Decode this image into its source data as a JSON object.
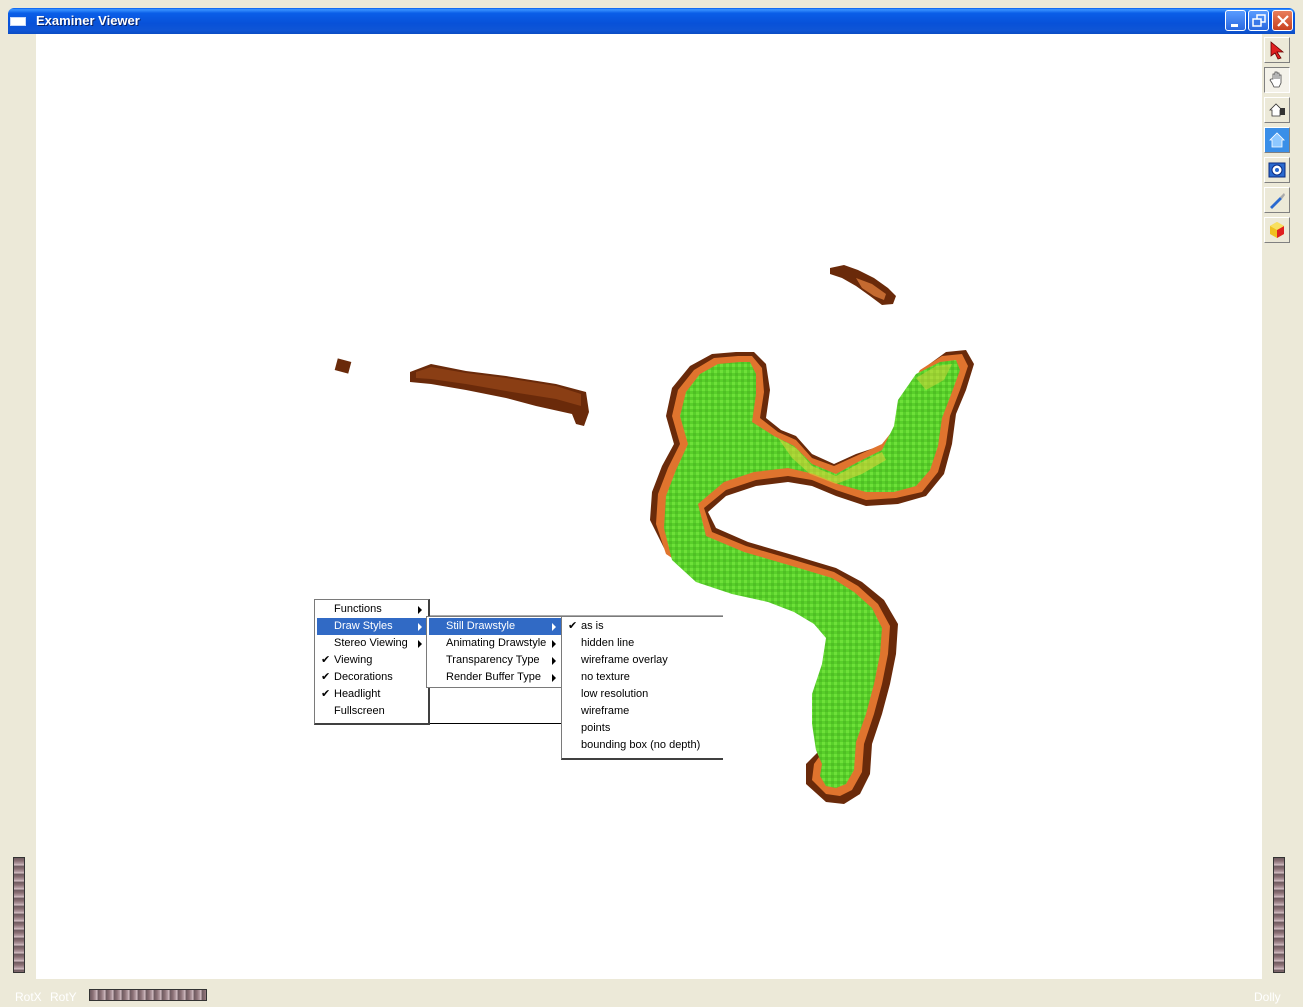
{
  "window": {
    "title": "Examiner Viewer",
    "buttons": [
      "minimize",
      "restore",
      "close"
    ]
  },
  "toolbar": {
    "tools": [
      {
        "name": "pick-arrow-icon",
        "pressed": false
      },
      {
        "name": "view-hand-icon",
        "pressed": true
      },
      {
        "name": "home-icon",
        "pressed": false
      },
      {
        "name": "set-home-icon",
        "pressed": false
      },
      {
        "name": "view-all-icon",
        "pressed": false
      },
      {
        "name": "seek-icon",
        "pressed": false
      },
      {
        "name": "perspective-cube-icon",
        "pressed": false
      }
    ]
  },
  "bottom_bar": {
    "rotx_label": "RotX",
    "roty_label": "RotY",
    "dolly_label": "Dolly"
  },
  "popup_menu": {
    "items": [
      {
        "label": "Functions",
        "checked": false,
        "submenu": true
      },
      {
        "label": "Draw Styles",
        "checked": false,
        "submenu": true,
        "selected": true
      },
      {
        "label": "Stereo Viewing",
        "checked": false,
        "submenu": true
      },
      {
        "label": "Viewing",
        "checked": true,
        "submenu": false
      },
      {
        "label": "Decorations",
        "checked": true,
        "submenu": false
      },
      {
        "label": "Headlight",
        "checked": true,
        "submenu": false
      },
      {
        "label": "Fullscreen",
        "checked": false,
        "submenu": false
      }
    ]
  },
  "draw_styles_menu": {
    "items": [
      {
        "label": "Still Drawstyle",
        "submenu": true,
        "selected": true
      },
      {
        "label": "Animating Drawstyle",
        "submenu": true
      },
      {
        "label": "Transparency Type",
        "submenu": true
      },
      {
        "label": "Render Buffer Type",
        "submenu": true
      }
    ]
  },
  "still_drawstyle_menu": {
    "items": [
      {
        "label": "as is",
        "checked": true
      },
      {
        "label": "hidden line",
        "checked": false
      },
      {
        "label": "wireframe overlay",
        "checked": false
      },
      {
        "label": "no texture",
        "checked": false
      },
      {
        "label": "low resolution",
        "checked": false
      },
      {
        "label": "wireframe",
        "checked": false
      },
      {
        "label": "points",
        "checked": false
      },
      {
        "label": "bounding box (no depth)",
        "checked": false
      }
    ]
  },
  "colors": {
    "titlebar": "#0a5ee8",
    "menu_highlight": "#316ac5",
    "model_fill": "#5ed62a",
    "model_edge": "#e0682a",
    "model_shadow": "#5a1e08"
  }
}
